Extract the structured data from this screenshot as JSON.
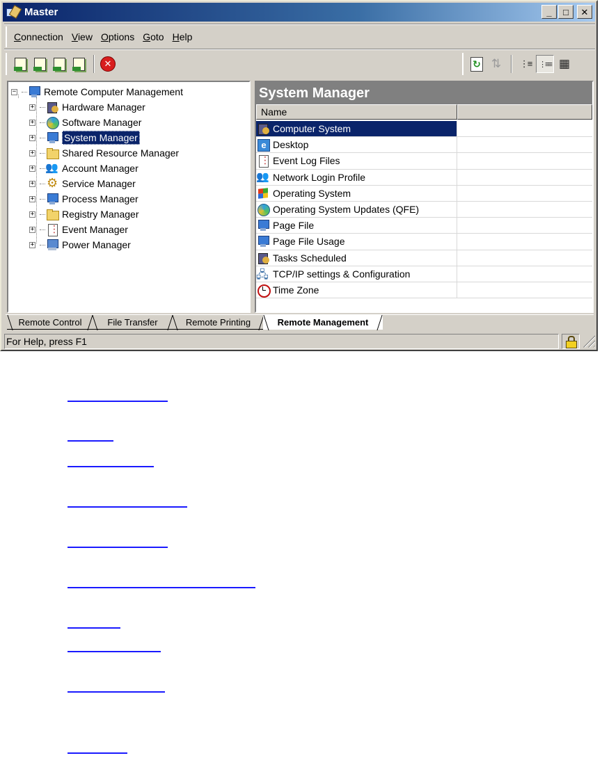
{
  "window": {
    "title": "Master",
    "buttons": {
      "minimize": "_",
      "maximize": "□",
      "close": "✕"
    }
  },
  "menu": [
    "Connection",
    "View",
    "Options",
    "Goto",
    "Help"
  ],
  "toolbar": {
    "left_icons": [
      "connect-icon",
      "transfer-icon",
      "print-icon",
      "manage-icon",
      "stop-icon"
    ],
    "right_icons": [
      "refresh-icon",
      "sync-icon",
      "list-view-icon",
      "detail-view-icon",
      "grid-view-icon"
    ]
  },
  "tree": {
    "root": "Remote Computer Management",
    "items": [
      {
        "label": "Hardware Manager",
        "icon": "chip"
      },
      {
        "label": "Software Manager",
        "icon": "disc"
      },
      {
        "label": "System Manager",
        "icon": "monitor",
        "selected": true
      },
      {
        "label": "Shared Resource Manager",
        "icon": "folder"
      },
      {
        "label": "Account Manager",
        "icon": "people"
      },
      {
        "label": "Service Manager",
        "icon": "gear"
      },
      {
        "label": "Process Manager",
        "icon": "monitor"
      },
      {
        "label": "Registry Manager",
        "icon": "folder"
      },
      {
        "label": "Event Manager",
        "icon": "log"
      },
      {
        "label": "Power Manager",
        "icon": "bolt"
      }
    ]
  },
  "list": {
    "title": "System Manager",
    "column": "Name",
    "rows": [
      {
        "label": "Computer System",
        "icon": "chip",
        "selected": true
      },
      {
        "label": "Desktop",
        "icon": "desk"
      },
      {
        "label": "Event Log Files",
        "icon": "log"
      },
      {
        "label": "Network Login Profile",
        "icon": "people"
      },
      {
        "label": "Operating System",
        "icon": "win"
      },
      {
        "label": "Operating System Updates (QFE)",
        "icon": "disc"
      },
      {
        "label": "Page File",
        "icon": "monitor"
      },
      {
        "label": "Page File Usage",
        "icon": "monitor"
      },
      {
        "label": "Tasks Scheduled",
        "icon": "chip"
      },
      {
        "label": "TCP/IP settings & Configuration",
        "icon": "net"
      },
      {
        "label": "Time Zone",
        "icon": "clock"
      }
    ]
  },
  "tabs": [
    {
      "label": "Remote Control"
    },
    {
      "label": "File Transfer"
    },
    {
      "label": "Remote Printing"
    },
    {
      "label": "Remote Management",
      "active": true
    }
  ],
  "status": {
    "text": "For Help, press F1",
    "icon": "lock-icon"
  },
  "colors": {
    "title_start": "#0a246a",
    "title_end": "#a6caf0",
    "selection": "#0a246a",
    "face": "#d4d0c8",
    "link": "#1a1aff"
  }
}
